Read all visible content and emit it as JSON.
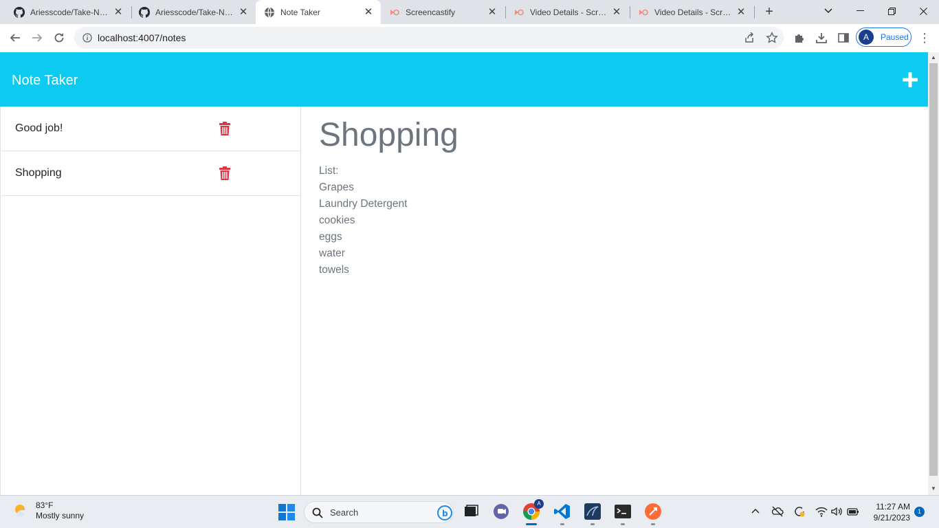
{
  "browser": {
    "tabs": [
      {
        "title": "Ariesscode/Take-Note",
        "icon": "github-icon",
        "active": false
      },
      {
        "title": "Ariesscode/Take-Note",
        "icon": "github-icon",
        "active": false
      },
      {
        "title": "Note Taker",
        "icon": "globe-icon",
        "active": true
      },
      {
        "title": "Screencastify",
        "icon": "screencastify-icon",
        "active": false
      },
      {
        "title": "Video Details - Screen",
        "icon": "screencastify-icon",
        "active": false
      },
      {
        "title": "Video Details - Screen",
        "icon": "screencastify-icon",
        "active": false
      }
    ],
    "url": "localhost:4007/notes",
    "profile": {
      "initial": "A",
      "status": "Paused"
    }
  },
  "app": {
    "title": "Note Taker",
    "accent_color": "#0dcaf0",
    "delete_color": "#dc3545",
    "notes": [
      {
        "title": "Good job!"
      },
      {
        "title": "Shopping"
      }
    ],
    "active_note": {
      "title": "Shopping",
      "body_lines": [
        "List:",
        "Grapes",
        "Laundry Detergent",
        "cookies",
        "eggs",
        "water",
        "towels"
      ]
    }
  },
  "taskbar": {
    "weather": {
      "temp": "83°F",
      "condition": "Mostly sunny"
    },
    "search_placeholder": "Search",
    "clock": {
      "time": "11:27 AM",
      "date": "9/21/2023"
    },
    "notification_count": "1",
    "chrome_badge": "A"
  }
}
